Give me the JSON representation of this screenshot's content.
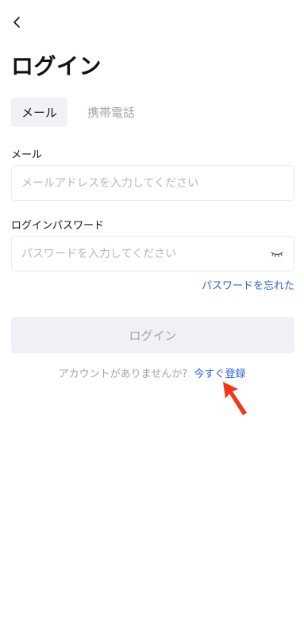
{
  "header": {
    "back_icon": "chevron-left-icon",
    "title": "ログイン"
  },
  "tabs": [
    {
      "label": "メール",
      "active": true
    },
    {
      "label": "携帯電話",
      "active": false
    }
  ],
  "email": {
    "label": "メール",
    "placeholder": "メールアドレスを入力してください",
    "value": ""
  },
  "password": {
    "label": "ログインパスワード",
    "placeholder": "パスワードを入力してください",
    "value": "",
    "toggle_icon": "eye-closed-icon"
  },
  "forgot_password": "パスワードを忘れた",
  "login_button": {
    "label": "ログイン",
    "enabled": false
  },
  "register": {
    "prompt": "アカウントがありませんか?",
    "link": "今すぐ登録"
  },
  "colors": {
    "accent": "#2e64d8",
    "annotation_arrow": "#f2361d",
    "disabled_button_bg": "#eff1f7"
  }
}
